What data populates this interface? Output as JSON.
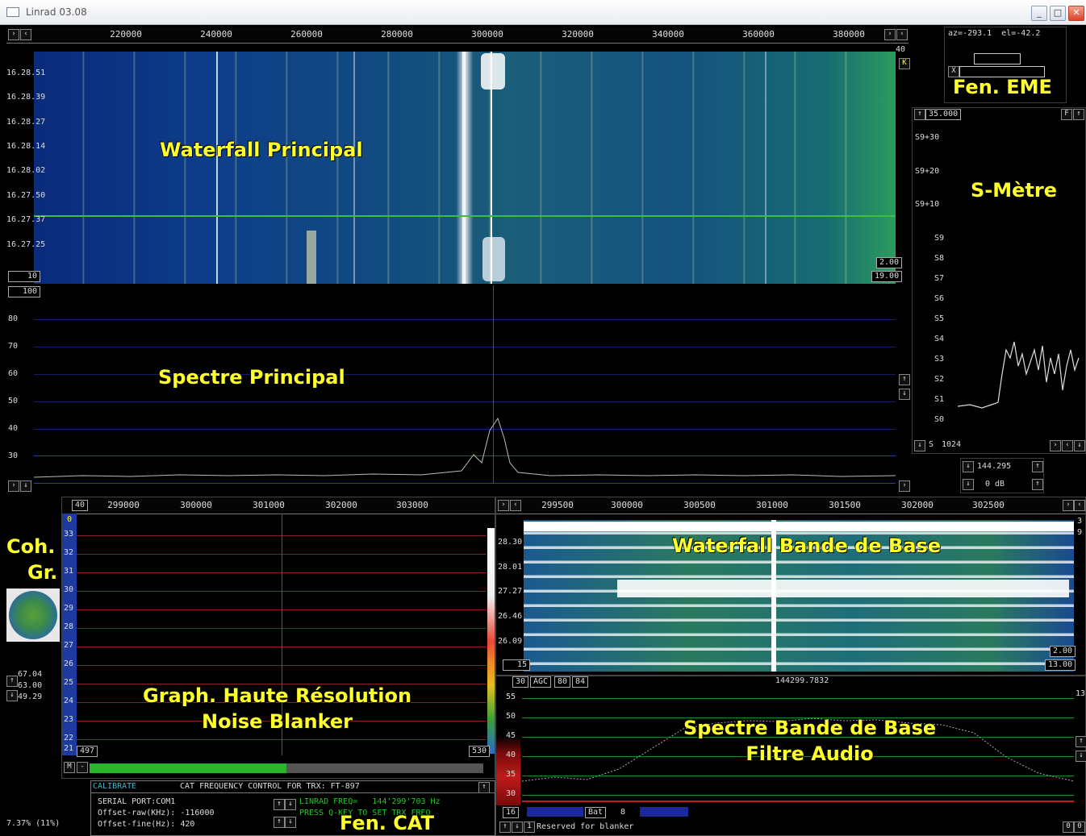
{
  "window": {
    "title": "Linrad 03.08",
    "minimize": "_",
    "maximize": "□",
    "close": "✕"
  },
  "main_freq_axis": [
    "220000",
    "240000",
    "260000",
    "280000",
    "300000",
    "320000",
    "340000",
    "360000",
    "380000"
  ],
  "waterfall_main": {
    "label": "Waterfall Principal",
    "times": [
      "16.28.51",
      "16.28.39",
      "16.28.27",
      "16.28.14",
      "16.28.02",
      "16.27.50",
      "16.27.37",
      "16.27.25"
    ],
    "gain_top": "40",
    "avg_box": "10",
    "spec_top": "100",
    "gain_box": "2.00",
    "offset_box": "19.00"
  },
  "spectrum_main": {
    "label": "Spectre Principal",
    "y_ticks": [
      "80",
      "70",
      "60",
      "50",
      "40",
      "30"
    ]
  },
  "eme": {
    "azel": "az=-293.1  el=-42.2",
    "label": "Fen. EME",
    "x_box": "X"
  },
  "smeter": {
    "label": "S-Mètre",
    "top_value": "35.000",
    "labels": [
      "S9+30",
      "S9+20",
      "S9+10",
      "S9",
      "S8",
      "S7",
      "S6",
      "S5",
      "S4",
      "S3",
      "S2",
      "S1",
      "S0"
    ],
    "bottom_value": "1024",
    "bottom_s": "S",
    "freq": "144.295",
    "db": "0 dB"
  },
  "coh": {
    "label_line1": "Coh.",
    "label_line2": "Gr.",
    "values": [
      "67.04",
      "63.00",
      "49.29"
    ],
    "bottom_text": "7.37% (11%)"
  },
  "hires": {
    "label_line1": "Graph. Haute Résolution",
    "label_line2": "Noise Blanker",
    "freq_axis": [
      "299000",
      "300000",
      "301000",
      "302000",
      "303000"
    ],
    "left_box": "40",
    "y_ticks": [
      "0",
      "33",
      "32",
      "31",
      "30",
      "29",
      "28",
      "27",
      "26",
      "25",
      "24",
      "23",
      "22",
      "21"
    ],
    "bottom_left": "497",
    "bottom_right": "530"
  },
  "baseband_wf": {
    "label": "Waterfall Bande de Base",
    "freq_axis": [
      "299500",
      "300000",
      "300500",
      "301000",
      "301500",
      "302000",
      "302500"
    ],
    "times": [
      "28.30",
      "28.01",
      "27.27",
      "26.46",
      "26.09"
    ],
    "right_top": "3",
    "right_second": "9",
    "gain_box": "2.00",
    "offset_box": "13.00",
    "bottom_left": "15"
  },
  "baseband_spec": {
    "label_line1": "Spectre Bande de Base",
    "label_line2": "Filtre Audio",
    "freq_readout": "144299.7832",
    "toolbar": [
      "30",
      "AGC",
      "80",
      "84"
    ],
    "y_ticks": [
      "55",
      "50",
      "45",
      "40",
      "35",
      "30"
    ],
    "right_num": "13",
    "bottom_left": "16",
    "bat_label": "Bat",
    "bat_value": "8",
    "reserved_text": "Reserved for blanker"
  },
  "cat": {
    "label": "Fen. CAT",
    "header_left": "CALIBRATE",
    "header_title": "CAT FREQUENCY CONTROL FOR TRX: FT-897",
    "serial_port": "SERIAL PORT:COM1",
    "offset_raw": "Offset-raw(KHz): -116000",
    "offset_fine": "Offset-fine(Hz): 420",
    "linrad_freq": "LINRAD FREQ=   144'299'703 Hz",
    "press_hint": "PRESS Q-KEY TO SET TRX FREQ"
  }
}
